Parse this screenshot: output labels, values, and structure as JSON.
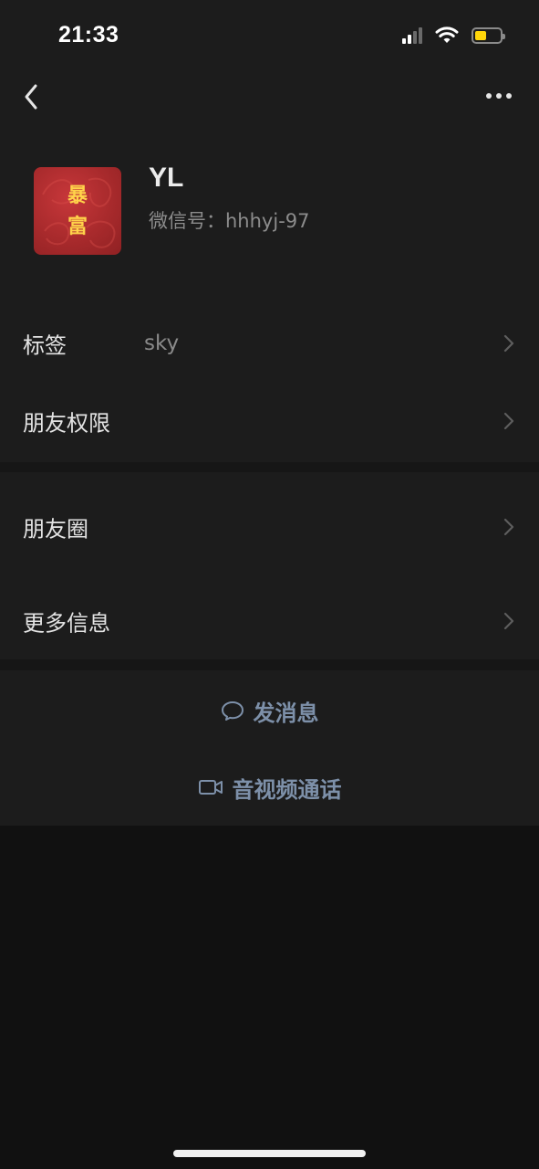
{
  "status_bar": {
    "time": "21:33"
  },
  "nav": {
    "back_icon": "chevron-left-icon",
    "more_icon": "more-horizontal-icon"
  },
  "profile": {
    "name": "YL",
    "wechat_id": "微信号：hhhyj-97",
    "avatar_text_top": "暴",
    "avatar_text_bottom": "富"
  },
  "list": {
    "tag_label": "标签",
    "tag_value": "sky",
    "permission_label": "朋友权限",
    "moments_label": "朋友圈",
    "more_info_label": "更多信息"
  },
  "actions": {
    "message_label": "发消息",
    "message_icon": "chat-bubble-icon",
    "call_label": "音视频通话",
    "call_icon": "video-camera-icon"
  },
  "colors": {
    "background": "#111111",
    "panel": "#1c1c1c",
    "action_text": "#7d90a9",
    "avatar_red": "#a82a2c",
    "avatar_gold": "#ffd24a",
    "battery": "#ffd60a"
  }
}
